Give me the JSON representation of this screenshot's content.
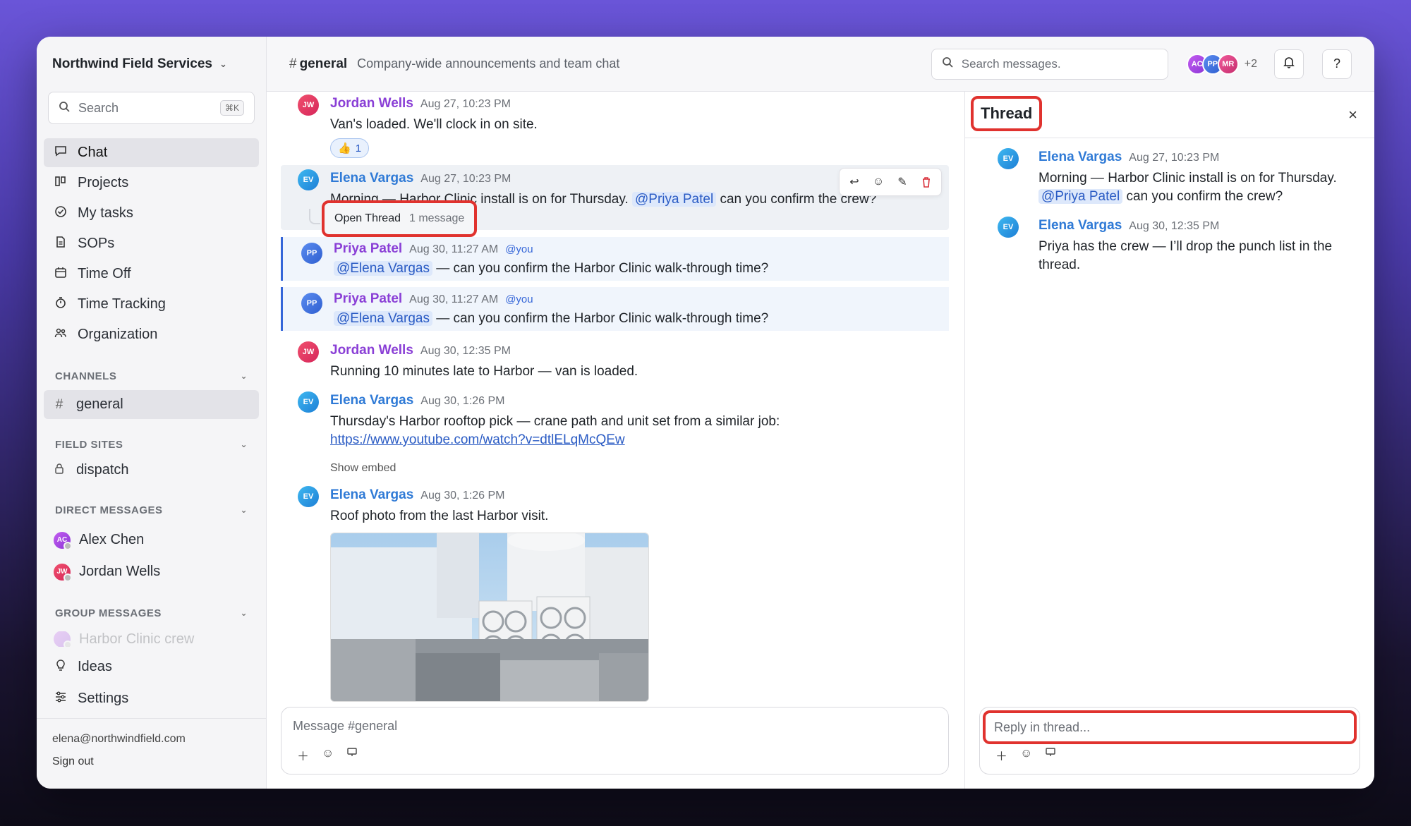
{
  "workspace": {
    "name": "Northwind Field Services"
  },
  "sidebar": {
    "search_placeholder": "Search",
    "search_shortcut": "⌘K",
    "nav": [
      {
        "label": "Chat",
        "icon": "chat-bubble-icon",
        "active": true
      },
      {
        "label": "Projects",
        "icon": "board-icon"
      },
      {
        "label": "My tasks",
        "icon": "check-circle-icon"
      },
      {
        "label": "SOPs",
        "icon": "document-icon"
      },
      {
        "label": "Time Off",
        "icon": "calendar-icon"
      },
      {
        "label": "Time Tracking",
        "icon": "stopwatch-icon"
      },
      {
        "label": "Organization",
        "icon": "people-icon"
      }
    ],
    "channels_header": "CHANNELS",
    "channels": [
      {
        "label": "general",
        "active": true
      }
    ],
    "field_sites_header": "FIELD SITES",
    "field_sites": [
      {
        "label": "dispatch"
      }
    ],
    "dm_header": "DIRECT MESSAGES",
    "dms": [
      {
        "initials": "AC",
        "label": "Alex Chen"
      },
      {
        "initials": "JW",
        "label": "Jordan Wells"
      }
    ],
    "group_header": "GROUP MESSAGES",
    "groups": [
      {
        "label": "Harbor Clinic crew"
      }
    ],
    "bottom_nav": [
      {
        "label": "Ideas",
        "icon": "lightbulb-icon"
      },
      {
        "label": "Settings",
        "icon": "sliders-icon"
      }
    ],
    "user_email": "elena@northwindfield.com",
    "sign_out": "Sign out"
  },
  "header": {
    "hash": "#",
    "channel": "general",
    "description": "Company-wide announcements and team chat",
    "search_placeholder": "Search messages.",
    "members": [
      "AC",
      "PP",
      "MR"
    ],
    "members_more": "+2",
    "bell_icon": "bell-icon",
    "help_label": "?"
  },
  "messages": [
    {
      "author": "Jordan Wells",
      "initials": "JW",
      "time": "Aug 27, 10:23 PM",
      "text": "Van's loaded. We'll clock in on site.",
      "reaction_emoji": "👍",
      "reaction_count": "1"
    },
    {
      "author": "Elena Vargas",
      "initials": "EV",
      "time": "Aug 27, 10:23 PM",
      "text_before": "Morning — Harbor Clinic install is on for Thursday.",
      "mention": "@Priya Patel",
      "text_after": "can you confirm the crew?",
      "open_thread": "Open Thread",
      "thread_count": "1 message"
    },
    {
      "author": "Priya Patel",
      "initials": "PP",
      "time": "Aug 30, 11:27 AM",
      "you_tag": "@you",
      "mention": "@Elena Vargas",
      "text_after": "— can you confirm the Harbor Clinic walk-through time?"
    },
    {
      "author": "Priya Patel",
      "initials": "PP",
      "time": "Aug 30, 11:27 AM",
      "you_tag": "@you",
      "mention": "@Elena Vargas",
      "text_after": "— can you confirm the Harbor Clinic walk-through time?"
    },
    {
      "author": "Jordan Wells",
      "initials": "JW",
      "time": "Aug 30, 12:35 PM",
      "text": "Running 10 minutes late to Harbor — van is loaded."
    },
    {
      "author": "Elena Vargas",
      "initials": "EV",
      "time": "Aug 30, 1:26 PM",
      "text": "Thursday's Harbor rooftop pick — crane path and unit set from a similar job:",
      "link": "https://www.youtube.com/watch?v=dtlELqMcQEw",
      "show_embed": "Show embed"
    },
    {
      "author": "Elena Vargas",
      "initials": "EV",
      "time": "Aug 30, 1:26 PM",
      "text": "Roof photo from the last Harbor visit."
    }
  ],
  "composer": {
    "placeholder": "Message #general"
  },
  "thread": {
    "title": "Thread",
    "close": "×",
    "messages": [
      {
        "author": "Elena Vargas",
        "initials": "EV",
        "time": "Aug 27, 10:23 PM",
        "text_before": "Morning — Harbor Clinic install is on for Thursday.",
        "mention": "@Priya Patel",
        "text_after": "can you confirm the crew?"
      },
      {
        "author": "Elena Vargas",
        "initials": "EV",
        "time": "Aug 30, 12:35 PM",
        "text": "Priya has the crew — I’ll drop the punch list in the thread."
      }
    ],
    "reply_placeholder": "Reply in thread..."
  },
  "colors": {
    "highlight": "#e0322e",
    "mention_bg": "#dde8fb",
    "link": "#2a5bc4"
  }
}
